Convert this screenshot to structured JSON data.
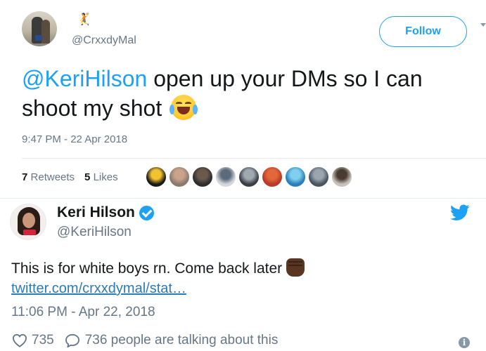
{
  "tweet1": {
    "name_emoji": "🤾",
    "handle": "@CrxxdyMal",
    "follow_label": "Follow",
    "mention": "@KeriHilson",
    "text": " open up your DMs so I can shoot my shot",
    "emoji": "face-with-tears-of-joy",
    "timestamp": "9:47 PM - 22 Apr 2018",
    "retweets_count": "7",
    "retweets_label": "Retweets",
    "likes_count": "5",
    "likes_label": "Likes",
    "liker_avatars": [
      {
        "color": "#1a1a1a",
        "accent": "#f2c230"
      },
      {
        "color": "#8a7a6e",
        "accent": "#c9a38a"
      },
      {
        "color": "#2e2e2e",
        "accent": "#6b5a4c"
      },
      {
        "color": "#d4d8dc",
        "accent": "#5c6b7a"
      },
      {
        "color": "#3a3f45",
        "accent": "#a0a8b0"
      },
      {
        "color": "#b83a2a",
        "accent": "#e2683a"
      },
      {
        "color": "#2a7fb8",
        "accent": "#7fd0f0"
      },
      {
        "color": "#4a5560",
        "accent": "#9aa5b0"
      },
      {
        "color": "#c8c3bc",
        "accent": "#4a3b30"
      }
    ]
  },
  "tweet2": {
    "name": "Keri Hilson",
    "handle": "@KeriHilson",
    "text": "This is for white boys rn. Come back later",
    "emoji": "raised-fist-dark-skin",
    "link": "twitter.com/crxxdymal/stat…",
    "timestamp": "11:06 PM - Apr 22, 2018",
    "likes_count": "735",
    "talking_text": "736 people are talking about this",
    "info_glyph": "i"
  }
}
